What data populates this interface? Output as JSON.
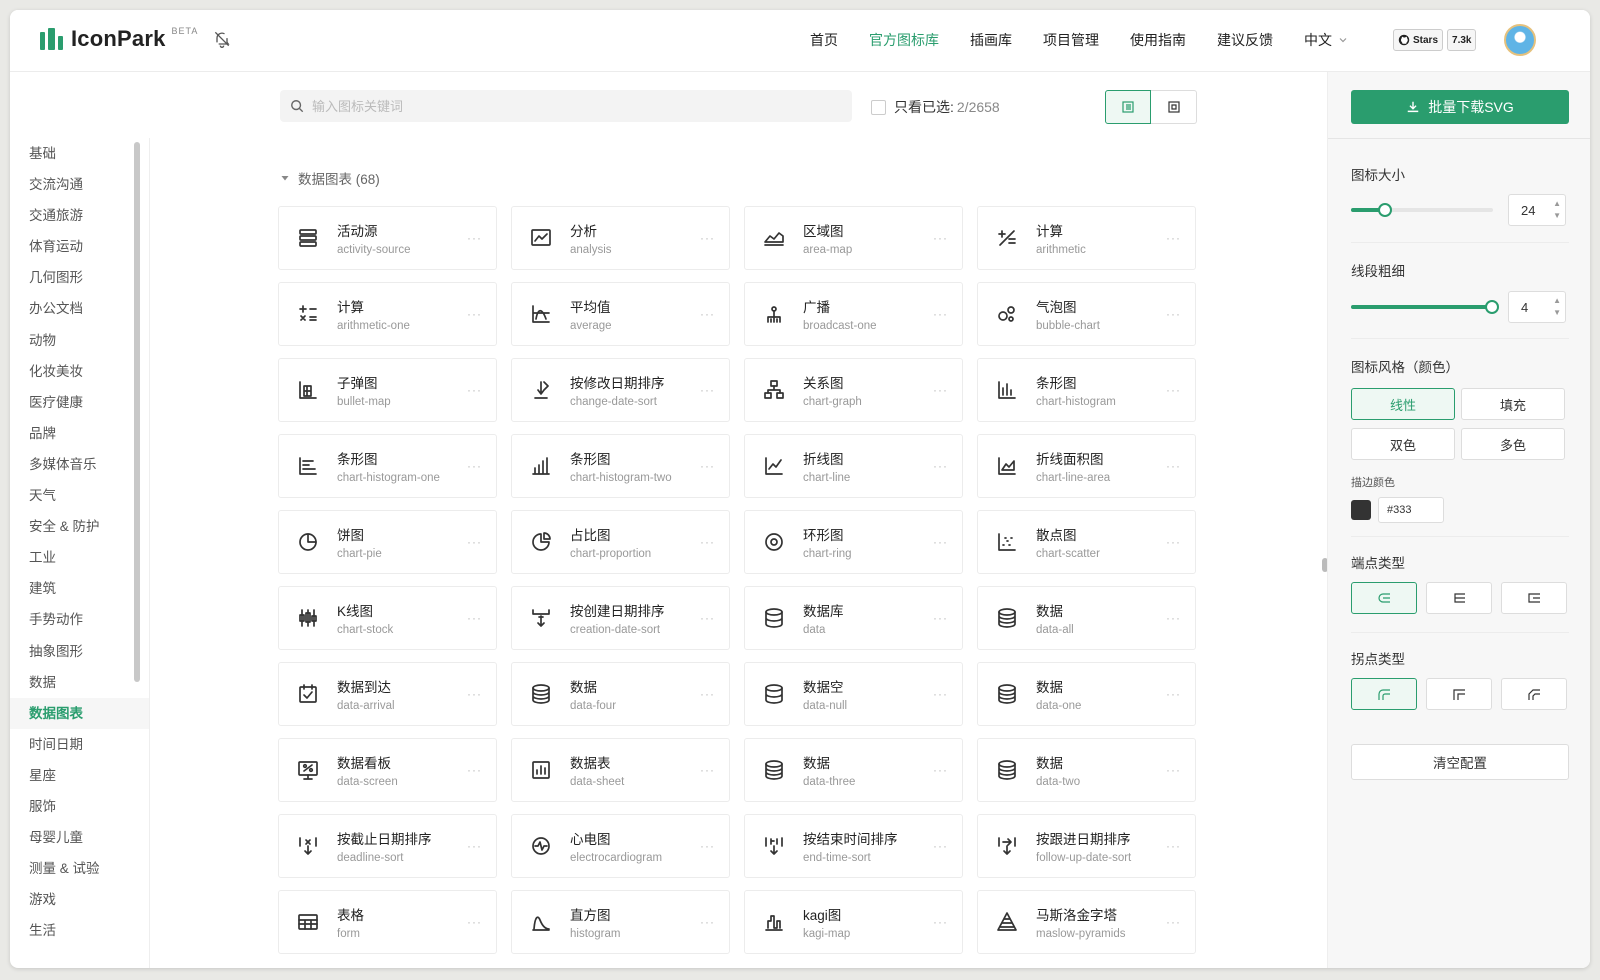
{
  "header": {
    "logo_text": "IconPark",
    "beta": "BETA",
    "nav": [
      "首页",
      "官方图标库",
      "插画库",
      "项目管理",
      "使用指南",
      "建议反馈"
    ],
    "active_nav": "官方图标库",
    "language": "中文",
    "github_stars_label": "Stars",
    "github_stars_count": "7.3k"
  },
  "toolbar": {
    "search_placeholder": "输入图标关键词",
    "only_selected_label": "只看已选:",
    "selected_count": "2/2658"
  },
  "categories": [
    "基础",
    "交流沟通",
    "交通旅游",
    "体育运动",
    "几何图形",
    "办公文档",
    "动物",
    "化妆美妆",
    "医疗健康",
    "品牌",
    "多媒体音乐",
    "天气",
    "安全 & 防护",
    "工业",
    "建筑",
    "手势动作",
    "抽象图形",
    "数据",
    "数据图表",
    "时间日期",
    "星座",
    "服饰",
    "母婴儿童",
    "测量 & 试验",
    "游戏",
    "生活"
  ],
  "active_category": "数据图表",
  "group": {
    "title": "数据图表 (68)"
  },
  "icons": [
    {
      "zh": "活动源",
      "en": "activity-source",
      "icon": "activity-source-icon"
    },
    {
      "zh": "分析",
      "en": "analysis",
      "icon": "analysis-icon"
    },
    {
      "zh": "区域图",
      "en": "area-map",
      "icon": "area-map-icon"
    },
    {
      "zh": "计算",
      "en": "arithmetic",
      "icon": "arithmetic-icon"
    },
    {
      "zh": "计算",
      "en": "arithmetic-one",
      "icon": "arithmetic-one-icon"
    },
    {
      "zh": "平均值",
      "en": "average",
      "icon": "average-icon"
    },
    {
      "zh": "广播",
      "en": "broadcast-one",
      "icon": "broadcast-icon"
    },
    {
      "zh": "气泡图",
      "en": "bubble-chart",
      "icon": "bubble-chart-icon"
    },
    {
      "zh": "子弹图",
      "en": "bullet-map",
      "icon": "bullet-map-icon"
    },
    {
      "zh": "按修改日期排序",
      "en": "change-date-sort",
      "icon": "change-date-sort-icon"
    },
    {
      "zh": "关系图",
      "en": "chart-graph",
      "icon": "chart-graph-icon"
    },
    {
      "zh": "条形图",
      "en": "chart-histogram",
      "icon": "chart-histogram-icon"
    },
    {
      "zh": "条形图",
      "en": "chart-histogram-one",
      "icon": "chart-histogram-one-icon"
    },
    {
      "zh": "条形图",
      "en": "chart-histogram-two",
      "icon": "chart-histogram-two-icon"
    },
    {
      "zh": "折线图",
      "en": "chart-line",
      "icon": "chart-line-icon"
    },
    {
      "zh": "折线面积图",
      "en": "chart-line-area",
      "icon": "chart-line-area-icon"
    },
    {
      "zh": "饼图",
      "en": "chart-pie",
      "icon": "chart-pie-icon"
    },
    {
      "zh": "占比图",
      "en": "chart-proportion",
      "icon": "chart-proportion-icon"
    },
    {
      "zh": "环形图",
      "en": "chart-ring",
      "icon": "chart-ring-icon"
    },
    {
      "zh": "散点图",
      "en": "chart-scatter",
      "icon": "chart-scatter-icon"
    },
    {
      "zh": "K线图",
      "en": "chart-stock",
      "icon": "chart-stock-icon"
    },
    {
      "zh": "按创建日期排序",
      "en": "creation-date-sort",
      "icon": "creation-date-sort-icon"
    },
    {
      "zh": "数据库",
      "en": "data",
      "icon": "database-icon"
    },
    {
      "zh": "数据",
      "en": "data-all",
      "icon": "data-all-icon"
    },
    {
      "zh": "数据到达",
      "en": "data-arrival",
      "icon": "data-arrival-icon"
    },
    {
      "zh": "数据",
      "en": "data-four",
      "icon": "data-four-icon"
    },
    {
      "zh": "数据空",
      "en": "data-null",
      "icon": "data-null-icon"
    },
    {
      "zh": "数据",
      "en": "data-one",
      "icon": "data-one-icon"
    },
    {
      "zh": "数据看板",
      "en": "data-screen",
      "icon": "data-screen-icon"
    },
    {
      "zh": "数据表",
      "en": "data-sheet",
      "icon": "data-sheet-icon"
    },
    {
      "zh": "数据",
      "en": "data-three",
      "icon": "data-three-icon"
    },
    {
      "zh": "数据",
      "en": "data-two",
      "icon": "data-two-icon"
    },
    {
      "zh": "按截止日期排序",
      "en": "deadline-sort",
      "icon": "deadline-sort-icon"
    },
    {
      "zh": "心电图",
      "en": "electrocardiogram",
      "icon": "electrocardiogram-icon"
    },
    {
      "zh": "按结束时间排序",
      "en": "end-time-sort",
      "icon": "end-time-sort-icon"
    },
    {
      "zh": "按跟进日期排序",
      "en": "follow-up-date-sort",
      "icon": "follow-up-date-sort-icon"
    },
    {
      "zh": "表格",
      "en": "form",
      "icon": "form-icon"
    },
    {
      "zh": "直方图",
      "en": "histogram",
      "icon": "histogram-icon"
    },
    {
      "zh": "kagi图",
      "en": "kagi-map",
      "icon": "kagi-map-icon"
    },
    {
      "zh": "马斯洛金字塔",
      "en": "maslow-pyramids",
      "icon": "maslow-pyramids-icon"
    }
  ],
  "more_label": "···",
  "panel": {
    "download_label": "批量下载SVG",
    "size_title": "图标大小",
    "size_value": "24",
    "size_fraction": 0.24,
    "stroke_title": "线段粗细",
    "stroke_value": "4",
    "stroke_fraction": 0.99,
    "style_title": "图标风格（颜色）",
    "styles": [
      "线性",
      "填充",
      "双色",
      "多色"
    ],
    "active_style": "线性",
    "stroke_color_label": "描边颜色",
    "stroke_color": "#333",
    "linecap_title": "端点类型",
    "linejoin_title": "拐点类型",
    "clear_label": "清空配置"
  },
  "colors": {
    "accent": "#2a9d6e",
    "text": "#333333",
    "muted": "#999999"
  }
}
